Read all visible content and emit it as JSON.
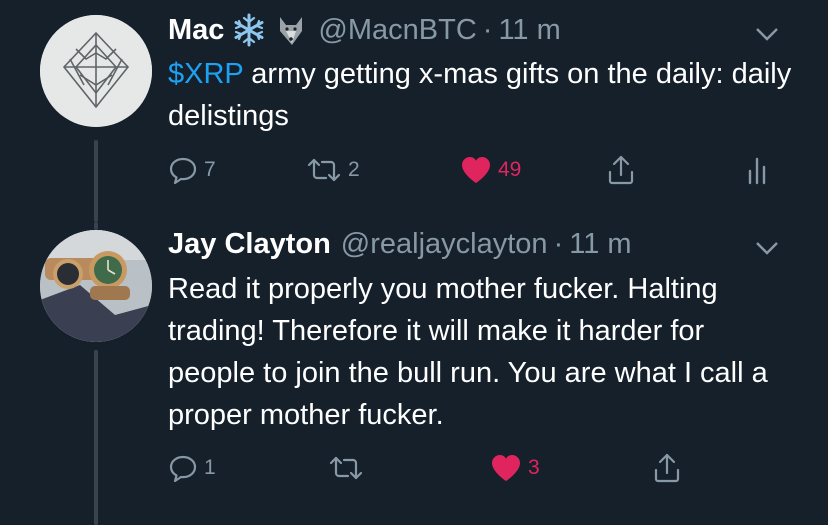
{
  "tweets": [
    {
      "name": "Mac",
      "emojis": [
        "snowflake-emoji",
        "wolf-emoji"
      ],
      "handle": "@MacnBTC",
      "separator": "·",
      "time": "11 m",
      "cashtag": "$XRP",
      "text": " army getting x-mas gifts on the daily: daily delistings",
      "replies": "7",
      "retweets": "2",
      "likes": "49",
      "liked": true
    },
    {
      "name": "Jay Clayton",
      "handle": "@realjayclayton",
      "separator": "·",
      "time": "11 m",
      "text": "Read it properly you mother fucker. Halting trading! Therefore it will make it harder for people to join the bull run. You are what I call a proper mother fucker.",
      "replies": "1",
      "retweets": "",
      "likes": "3",
      "liked": true
    }
  ],
  "colors": {
    "background": "#15202b",
    "muted": "#8899a6",
    "link": "#1da1f2",
    "like": "#e0245e",
    "thread_line": "#38444d"
  }
}
